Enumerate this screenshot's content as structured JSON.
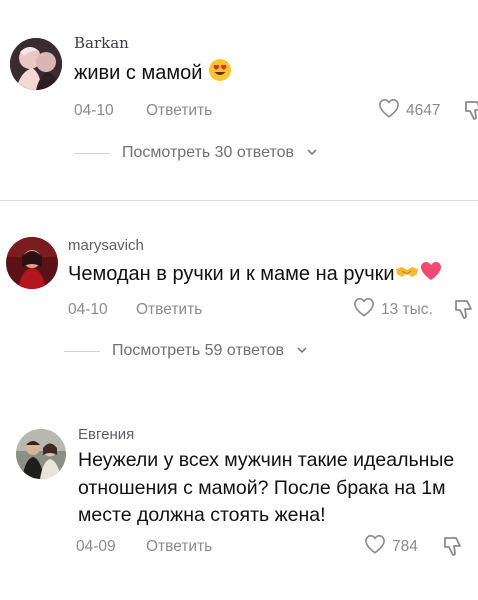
{
  "comments": [
    {
      "username": "Barkan",
      "text": "живи с мамой",
      "date": "04-10",
      "reply_label": "Ответить",
      "likes": "4647",
      "replies_label": "Посмотреть 30 ответов"
    },
    {
      "username": "marysavich",
      "text": "Чемодан в ручки и к маме на ручки",
      "date": "04-10",
      "reply_label": "Ответить",
      "likes": "13 тыс.",
      "replies_label": "Посмотреть 59 ответов"
    },
    {
      "username": "Евгения",
      "text": "Неужели у всех мужчин такие идеальные отношения с мамой? После брака на 1м месте должна стоять жена!",
      "date": "04-09",
      "reply_label": "Ответить",
      "likes": "784"
    }
  ],
  "icons": {
    "emoji_1": "heart-eyes-emoji-icon",
    "emoji_2": "handshake-emoji-icon",
    "emoji_3": "pink-heart-emoji-icon",
    "like": "heart-outline-icon",
    "dislike": "thumbs-down-outline-icon",
    "expand": "chevron-down-icon"
  },
  "colors": {
    "background": "#ffffff",
    "meta_text": "#8a8b91",
    "divider": "#dcdcdc"
  }
}
